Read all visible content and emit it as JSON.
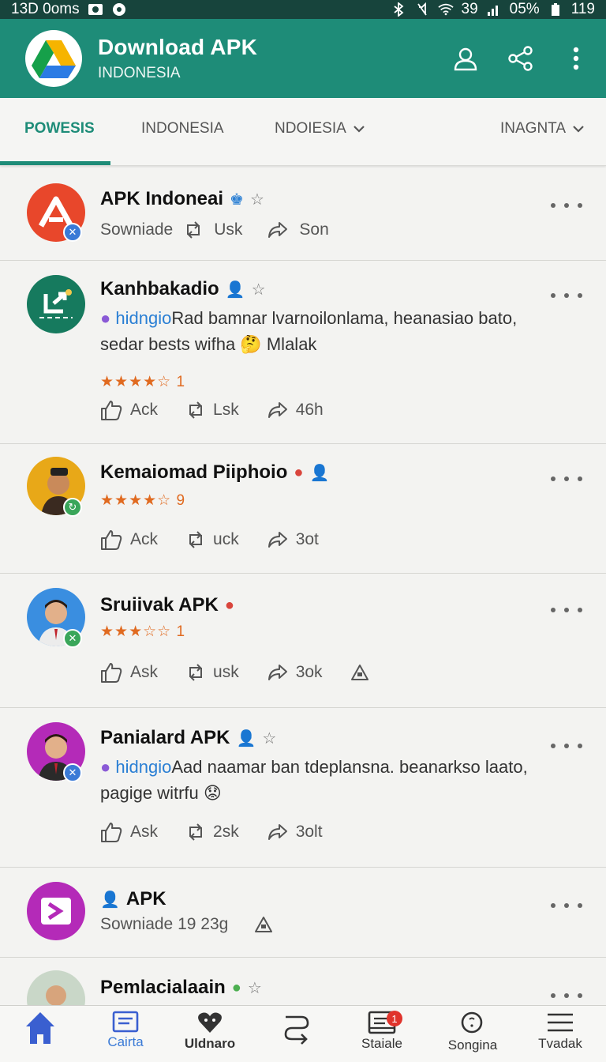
{
  "status_bar": {
    "left_text": "13D 0oms",
    "right_text": "39",
    "battery": "05%",
    "extra": "119"
  },
  "app_bar": {
    "title": "Download APK",
    "subtitle": "INDONESIA",
    "icons": [
      "profile-icon",
      "share-icon",
      "more-vert-icon"
    ],
    "color": "#1e8c78"
  },
  "tabs": [
    {
      "label": "POWESIS",
      "active": true
    },
    {
      "label": "INDONESIA",
      "active": false
    },
    {
      "label": "NDOIESIA",
      "active": false
    },
    {
      "label": "INAGNTA",
      "active": false
    }
  ],
  "posts": [
    {
      "name": "APK Indoneai",
      "meta": [
        "Sowniade",
        "Usk",
        "Son"
      ],
      "actions": []
    },
    {
      "name": "Kanhbakadio",
      "tag": "hidngio",
      "body_1": "Rad bamnar lvarnoilonlama, heanasiao bato,",
      "body_2": "sedar bests wifha",
      "body_3": "Mlalak",
      "rating_count": "1",
      "rating": 4.5,
      "actions": [
        "Ack",
        "Lsk",
        "46h"
      ]
    },
    {
      "name": "Kemaiomad Piiphoio",
      "rating_count": "9",
      "rating": 4.5,
      "actions": [
        "Ack",
        "uck",
        "3ot"
      ]
    },
    {
      "name": "Sruiivak APK",
      "rating_count": "1",
      "rating": 3.5,
      "actions": [
        "Ask",
        "usk",
        "3ok"
      ]
    },
    {
      "name": "Panialard APK",
      "tag": "hidngio",
      "body_1": "Aad  naamar ban tdeplansna. beanarkso laato,",
      "body_2": "pagige witrfu",
      "actions": [
        "Ask",
        "2sk",
        "3olt"
      ]
    },
    {
      "name": "APK",
      "meta_text": "Sowniade 19 23g"
    },
    {
      "name": "Pemlacialaain"
    }
  ],
  "bottom_nav": [
    {
      "label": "",
      "icon": "home-icon",
      "active": false
    },
    {
      "label": "Cairta",
      "icon": "card-icon",
      "active": true
    },
    {
      "label": "Uldnaro",
      "icon": "heart-chat-icon",
      "active": false
    },
    {
      "label": "",
      "icon": "route-icon",
      "active": false
    },
    {
      "label": "Staiale",
      "icon": "inbox-icon",
      "active": false,
      "badge": "1"
    },
    {
      "label": "Songina",
      "icon": "search-icon",
      "active": false
    },
    {
      "label": "Tvadak",
      "icon": "menu-icon",
      "active": false
    }
  ]
}
